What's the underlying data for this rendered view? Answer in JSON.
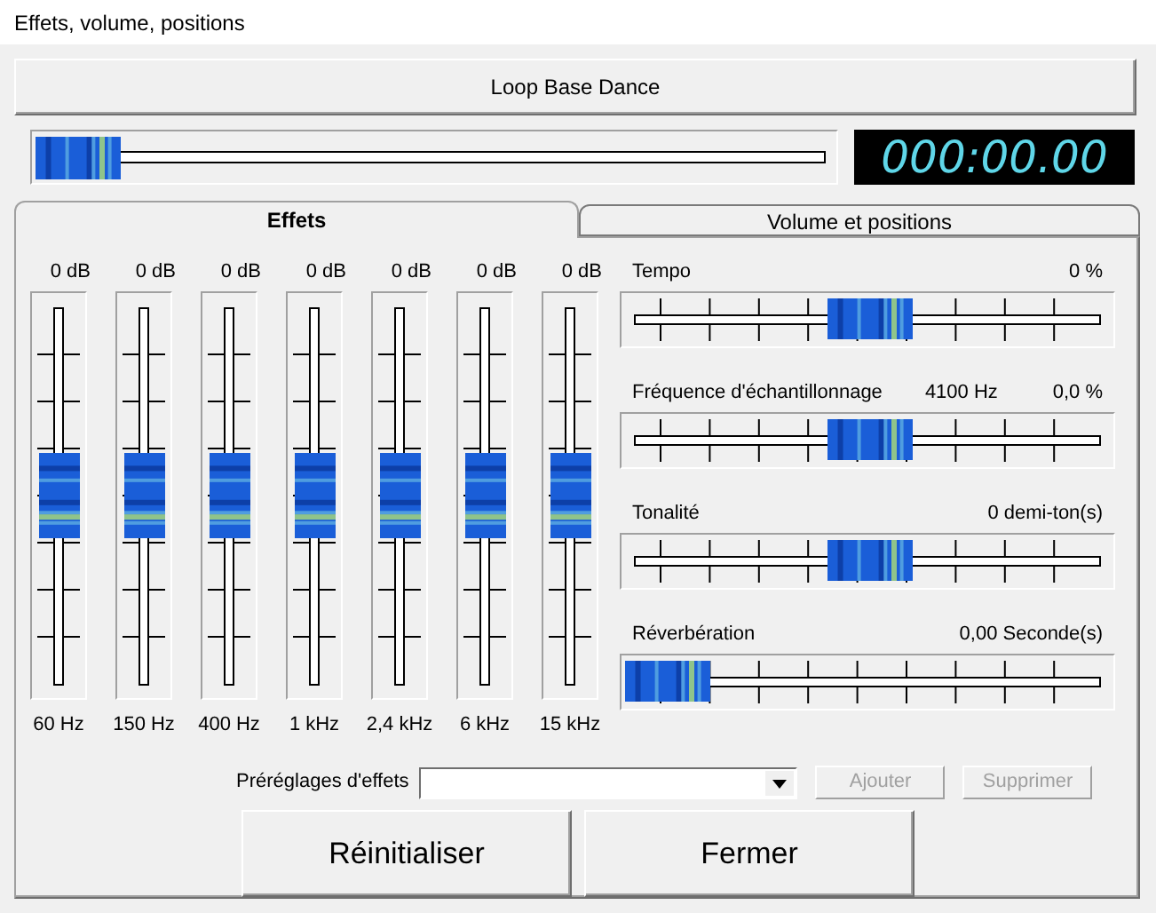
{
  "window": {
    "title": "Effets, volume, positions"
  },
  "track_button": {
    "label": "Loop Base Dance"
  },
  "position": {
    "level": 0
  },
  "time_display": "000:00.00",
  "tabs": [
    {
      "label": "Effets",
      "selected": true
    },
    {
      "label": "Volume et positions",
      "selected": false
    }
  ],
  "equalizer": [
    {
      "reading": "0 dB",
      "level": 0.5,
      "band": "60 Hz"
    },
    {
      "reading": "0 dB",
      "level": 0.5,
      "band": "150 Hz"
    },
    {
      "reading": "0 dB",
      "level": 0.5,
      "band": "400 Hz"
    },
    {
      "reading": "0 dB",
      "level": 0.5,
      "band": "1 kHz"
    },
    {
      "reading": "0 dB",
      "level": 0.5,
      "band": "2,4 kHz"
    },
    {
      "reading": "0 dB",
      "level": 0.5,
      "band": "6 kHz"
    },
    {
      "reading": "0 dB",
      "level": 0.5,
      "band": "15 kHz"
    }
  ],
  "effects": [
    {
      "label": "Tempo",
      "reading": "0 %",
      "level": 0.5
    },
    {
      "label": "Fréquence d'échantillonnage",
      "detail": "4100 Hz",
      "reading": "0,0 %",
      "level": 0.5
    },
    {
      "label": "Tonalité",
      "reading": "0 demi-ton(s)",
      "level": 0.5
    },
    {
      "label": "Réverbération",
      "reading": "0,00 Seconde(s)",
      "level": 0
    }
  ],
  "presets": {
    "label": "Préréglages d'effets",
    "buttons": [
      {
        "label": "Ajouter",
        "disabled": true
      },
      {
        "label": "Supprimer",
        "disabled": true
      }
    ]
  },
  "buttons": [
    "Réinitialiser",
    "Fermer"
  ]
}
